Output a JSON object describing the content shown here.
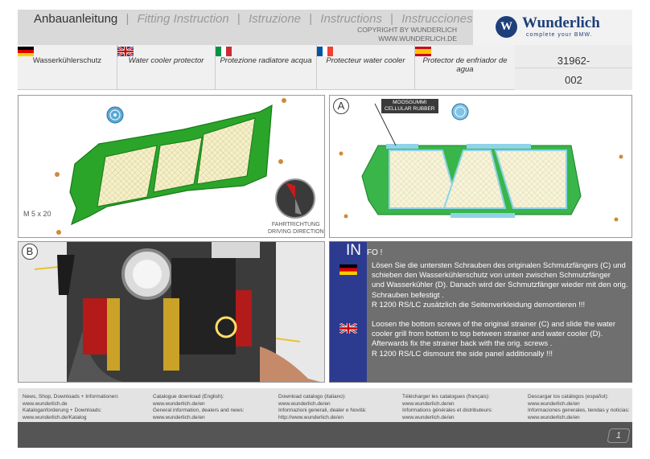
{
  "header": {
    "title_de": "Anbauanleitung",
    "title_en": "Fitting Instruction",
    "title_it": "Istruzione",
    "title_fr": "Instructions",
    "title_es": "Instrucciones",
    "separator": "|",
    "copyright": "COPYRIGHT BY WUNDERLICH",
    "website": "WWW.WUNDERLICH.DE"
  },
  "brand": {
    "logo_letter": "W",
    "name": "Wunderlich",
    "tagline": "complete your BMW."
  },
  "languages": [
    {
      "code": "de",
      "label": "Wasserkühlerschutz"
    },
    {
      "code": "en",
      "label": "Water cooler protector"
    },
    {
      "code": "it",
      "label": "Protezione radiatore acqua"
    },
    {
      "code": "fr",
      "label": "Protecteur water cooler"
    },
    {
      "code": "es",
      "label": "Protector de enfriador de agua"
    }
  ],
  "article": {
    "line1": "31962-",
    "line2": "002"
  },
  "panel1": {
    "screw_label": "M 5 x 20",
    "direction_de": "FAHRTRICHTUNG",
    "direction_en": "DRIVING DIRECTION"
  },
  "panel2": {
    "marker": "A",
    "rubber_de": "MOOSGUMMI",
    "rubber_en": "CELLULAR RUBBER"
  },
  "panel3": {
    "marker": "B"
  },
  "info": {
    "word": "IN",
    "word2": "FO !",
    "de_text": [
      "Lösen Sie die untersten Schrauben des originalen Schmutzfängers (C) und",
      " schieben den Wasserkühlerschutz von unten zwischen Schmutzfänger",
      " und Wasserkühler (D). Danach wird der Schmutzfänger wieder mit den orig.",
      " Schrauben befestigt .",
      "R 1200 RS/LC zusätzlich die Seitenverkleidung demontieren !!!"
    ],
    "en_text": [
      "Loosen the bottom screws of the original strainer (C) and slide the water",
      "cooler grill from bottom to top between strainer and water cooler (D).",
      "Afterwards fix the strainer back with the orig. screws .",
      "R 1200 RS/LC dismount the side panel additionally !!!"
    ]
  },
  "footer": {
    "cols": [
      {
        "l1": "News, Shop, Downloads + Informationen:",
        "l2": "www.wunderlich.de",
        "l3": "Kataloganforderung + Downloads:",
        "l4": "www.wunderlich.de/Katalog"
      },
      {
        "l1": "Catalogue download (English):",
        "l2": "www.wunderlich.de/en",
        "l3": "General information, dealers and news:",
        "l4": "www.wunderlich.de/en"
      },
      {
        "l1": "Download catalogo (italiano):",
        "l2": "www.wunderlich.de/en",
        "l3": "Informazioni generali, dealer e Novità:",
        "l4": "http://www.wunderlich.de/en"
      },
      {
        "l1": "Télécharger les catalogues (français):",
        "l2": "www.wunderlich.de/en",
        "l3": "Informations générales et distributeurs:",
        "l4": "www.wunderlich.de/en"
      },
      {
        "l1": "Descargar los catálogos (español):",
        "l2": "www.wunderlich.de/en",
        "l3": "Informaciones generales, tiendas y noticias:",
        "l4": "www.wunderlich.de/en"
      }
    ],
    "page_number": "1"
  }
}
